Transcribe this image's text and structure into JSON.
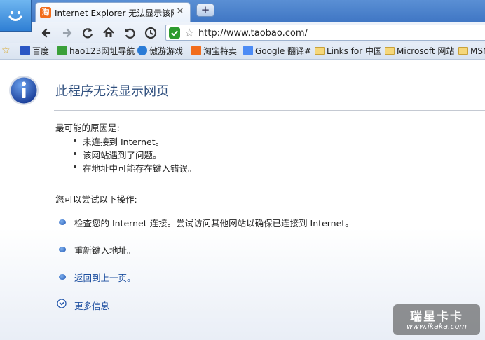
{
  "tab": {
    "favicon_char": "淘",
    "title": "Internet Explorer 无法显示该网...",
    "close_glyph": "✕",
    "new_tab_glyph": "+"
  },
  "address": {
    "url": "http://www.taobao.com/"
  },
  "bookmarks": [
    {
      "label": "百度",
      "icon": "baidu-paw-icon"
    },
    {
      "label": "hao123网址导航",
      "icon": "hao123-icon"
    },
    {
      "label": "傲游游戏",
      "icon": "maxthon-games-icon"
    },
    {
      "label": "淘宝特卖",
      "icon": "taobao-icon"
    },
    {
      "label": "Google 翻译#",
      "icon": "google-translate-icon"
    },
    {
      "label": "Links for 中国",
      "icon": "folder-icon"
    },
    {
      "label": "Microsoft 网站",
      "icon": "folder-icon"
    },
    {
      "label": "MSN",
      "icon": "folder-icon"
    }
  ],
  "page": {
    "title": "此程序无法显示网页",
    "causes_heading": "最可能的原因是:",
    "causes": [
      "未连接到 Internet。",
      "该网站遇到了问题。",
      "在地址中可能存在键入错误。"
    ],
    "actions_heading": "您可以尝试以下操作:",
    "actions": [
      "检查您的 Internet 连接。尝试访问其他网站以确保已连接到 Internet。",
      "重新键入地址。",
      "返回到上一页。"
    ],
    "more_info": "更多信息"
  },
  "watermark": {
    "logo_text": "瑞星卡卡",
    "url": "www.ikaka.com"
  },
  "colors": {
    "tab_strip": "#4a82cc",
    "title_blue": "#2f4f7e",
    "link_blue": "#1d4fa0"
  }
}
